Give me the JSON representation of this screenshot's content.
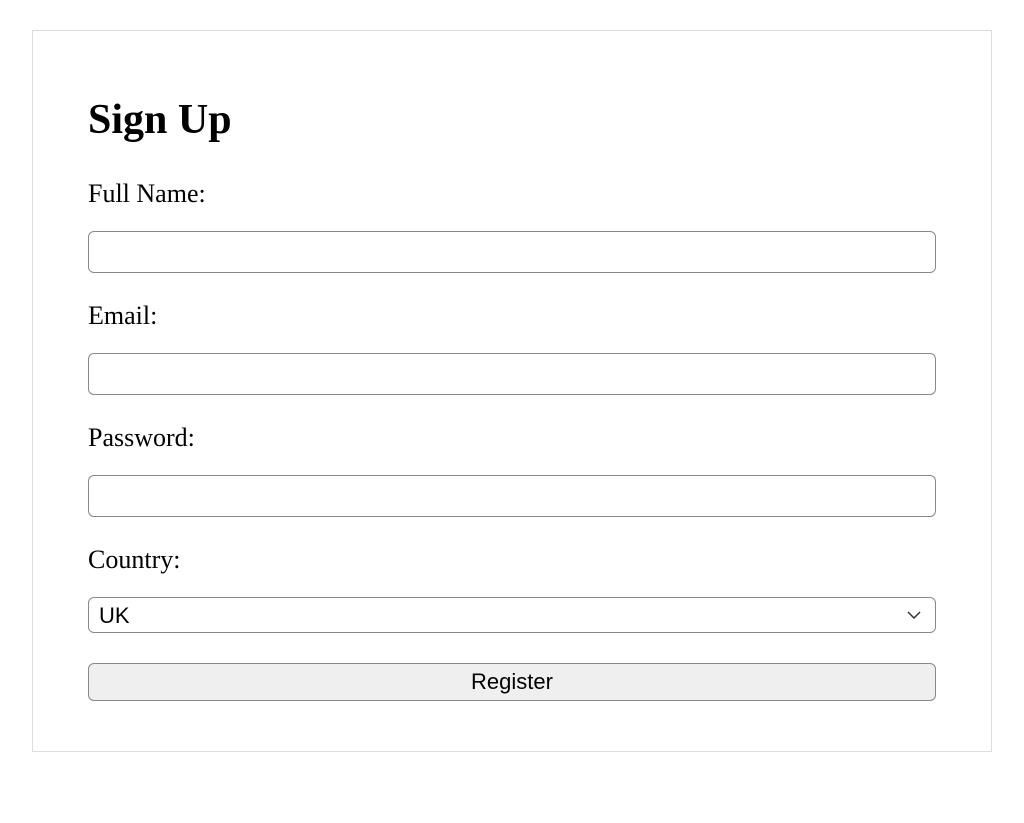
{
  "form": {
    "title": "Sign Up",
    "full_name": {
      "label": "Full Name:",
      "value": ""
    },
    "email": {
      "label": "Email:",
      "value": ""
    },
    "password": {
      "label": "Password:",
      "value": ""
    },
    "country": {
      "label": "Country:",
      "selected": "UK"
    },
    "submit_label": "Register"
  }
}
